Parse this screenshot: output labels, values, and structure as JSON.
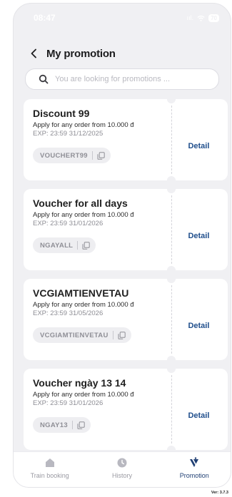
{
  "status_bar": {
    "time": "08:47",
    "signal": "ııl.",
    "battery": "70"
  },
  "header": {
    "title": "My promotion",
    "back_icon": "chevron-left-icon"
  },
  "search": {
    "placeholder": "You are looking for promotions ...",
    "value": "",
    "icon": "search-icon"
  },
  "vouchers": [
    {
      "title": "Discount 99",
      "description": "Apply for any order from 10.000 đ",
      "expiry": "EXP: 23:59 31/12/2025",
      "code": "VOUCHERT99",
      "detail_label": "Detail"
    },
    {
      "title": "Voucher for all days",
      "description": "Apply for any order from 10.000 đ",
      "expiry": "EXP: 23:59 31/01/2026",
      "code": "NGAYALL",
      "detail_label": "Detail"
    },
    {
      "title": "VCGIAMTIENVETAU",
      "description": "Apply for any order from 10.000 đ",
      "expiry": "EXP: 23:59 31/05/2026",
      "code": "VCGIAMTIENVETAU",
      "detail_label": "Detail"
    },
    {
      "title": "Voucher ngày 13 14",
      "description": "Apply for any order from 10.000 đ",
      "expiry": "EXP: 23:59 31/01/2026",
      "code": "NGAY13",
      "detail_label": "Detail"
    }
  ],
  "tabbar": {
    "tabs": [
      {
        "label": "Train booking",
        "icon": "home-icon",
        "active": false
      },
      {
        "label": "History",
        "icon": "clock-icon",
        "active": false
      },
      {
        "label": "Promotion",
        "icon": "promotion-icon",
        "active": true
      }
    ]
  },
  "version": "Ver: 3.7.3",
  "colors": {
    "accent": "#1f4e8c",
    "background": "#f0f0f3",
    "inactive": "#9a9aa2"
  }
}
